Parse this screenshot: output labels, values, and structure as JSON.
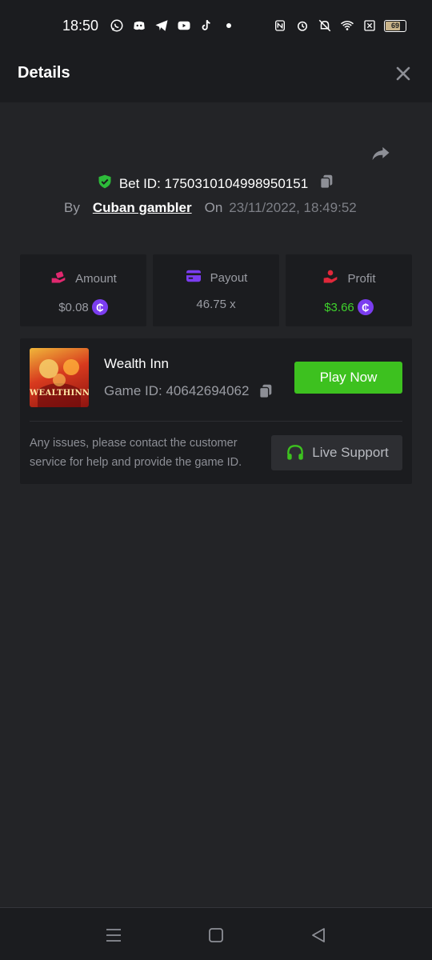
{
  "status_bar": {
    "time": "18:50",
    "battery": "69",
    "left_icons": [
      "whatsapp-icon",
      "discord-icon",
      "telegram-icon",
      "youtube-icon",
      "tiktok-icon",
      "dot-icon"
    ],
    "right_icons": [
      "nfc-icon",
      "alarm-icon",
      "bell-off-icon",
      "wifi-icon",
      "close-box-icon",
      "battery-icon"
    ]
  },
  "header": {
    "title": "Details"
  },
  "bet": {
    "id_label": "Bet ID: 1750310104998950151",
    "by_label": "By",
    "user": "Cuban gambler",
    "on_label": "On",
    "date": "23/11/2022, 18:49:52"
  },
  "stats": [
    {
      "label": "Amount",
      "value": "$0.08",
      "icon": "hand-coins-icon",
      "color": "#e0286f",
      "coin": true,
      "value_color": "#9a9ca3"
    },
    {
      "label": "Payout",
      "value": "46.75 x",
      "icon": "card-icon",
      "color": "#7b3df0",
      "coin": false,
      "value_color": "#9a9ca3"
    },
    {
      "label": "Profit",
      "value": "$3.66",
      "icon": "profit-hand-icon",
      "color": "#e0283a",
      "coin": true,
      "value_color": "#3fd12c"
    }
  ],
  "coin_symbol": "₵",
  "game": {
    "name": "Wealth Inn",
    "id_label": "Game ID: 40642694062",
    "thumb_text": "WEALTHINN",
    "play_label": "Play Now",
    "help_text": "Any issues, please contact the customer service for help and provide the game ID.",
    "support_label": "Live Support"
  },
  "colors": {
    "accent_green": "#3dc11f",
    "shield_green": "#2dbb3a",
    "background": "#232427",
    "panel": "#1b1c1f"
  }
}
